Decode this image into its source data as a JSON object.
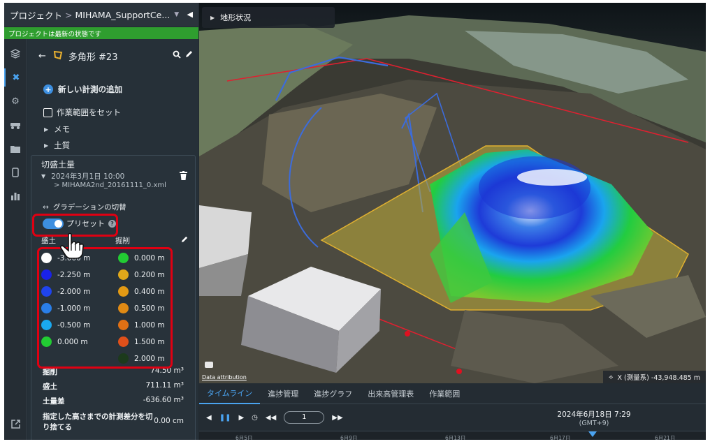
{
  "topbar": {
    "project_label": "プロジェクト",
    "separator": ">",
    "project_name": "MIHAMA_SupportCe...",
    "dropdown_icon": "chevron-down-icon",
    "collapse_icon": "collapse-left-icon"
  },
  "status": {
    "text": "プロジェクトは最新の状態です",
    "color": "#2f9e2f"
  },
  "rail": {
    "icons": [
      "layers-icon",
      "measure-tools-icon",
      "gear-icon",
      "vehicle-icon",
      "folder-icon",
      "device-icon",
      "chart-icon",
      "export-icon"
    ]
  },
  "panel": {
    "back_icon": "arrow-left-icon",
    "polygon_icon": "polygon-icon",
    "title": "多角形 #23",
    "add_measure": "新しい計測の追加",
    "work_area": "作業範囲をセット",
    "memo": "メモ",
    "soil": "土質",
    "card": {
      "title": "切盛土量",
      "date": "2024年3月1日 10:00",
      "file": "> MIHAMA2nd_20161111_0.xml",
      "gradient_toggle": "グラデーションの切替",
      "preset_label": "プリセット",
      "help": "?",
      "fill_header": "盛土",
      "cut_header": "掘削",
      "fill_legend": [
        {
          "value": "-3.000 m",
          "color": "#ffffff"
        },
        {
          "value": "-2.250 m",
          "color": "#1a22e8"
        },
        {
          "value": "-2.000 m",
          "color": "#1f44ee"
        },
        {
          "value": "-1.000 m",
          "color": "#2a7fe8"
        },
        {
          "value": "-0.500 m",
          "color": "#1aa9f0"
        },
        {
          "value": "0.000 m",
          "color": "#22cc33"
        }
      ],
      "cut_legend": [
        {
          "value": "0.000 m",
          "color": "#22cc33"
        },
        {
          "value": "0.200 m",
          "color": "#e0a81a"
        },
        {
          "value": "0.400 m",
          "color": "#e39a14"
        },
        {
          "value": "0.500 m",
          "color": "#e08a14"
        },
        {
          "value": "1.000 m",
          "color": "#e07014"
        },
        {
          "value": "1.500 m",
          "color": "#e0501a"
        },
        {
          "value": "2.000 m",
          "color": "#1c3a1c"
        }
      ],
      "stats": [
        {
          "label": "掘削",
          "value": "74.50 m³"
        },
        {
          "label": "盛土",
          "value": "711.11 m³"
        },
        {
          "label": "土量差",
          "value": "-636.60 m³"
        }
      ],
      "diff_label_1": "指定した高さまでの計測差分を切",
      "diff_label_2": "り捨てる",
      "diff_value": "0.00 cm"
    }
  },
  "map": {
    "chip_label": "地形状況",
    "attribution": "Data attribution",
    "coord": "X (測量系) -43,948.485 m"
  },
  "timeline": {
    "tabs": [
      "タイムライン",
      "進捗管理",
      "進捗グラフ",
      "出来高管理表",
      "作業範囲"
    ],
    "speed": "1",
    "datetime": "2024年6月18日 7:29",
    "timezone": "(GMT+9)",
    "ticks": [
      "6月5日",
      "6月9日",
      "6月13日",
      "6月17日",
      "6月21日"
    ]
  }
}
